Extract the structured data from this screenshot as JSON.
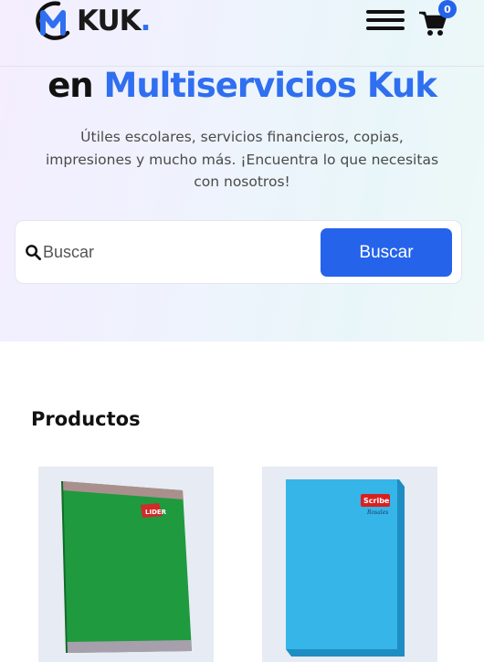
{
  "header": {
    "logo_text": "KUK",
    "logo_dot": ".",
    "cart_count": "0"
  },
  "hero": {
    "title_prefix": "en ",
    "title_accent": "Multiservicios Kuk",
    "description": "Útiles escolares, servicios financieros, copias, impresiones y mucho más. ¡Encuentra lo que necesitas con nosotros!"
  },
  "search": {
    "placeholder": "Buscar",
    "button_label": "Buscar"
  },
  "products": {
    "title": "Productos",
    "items": [
      {
        "brand": "LIDER",
        "cover_color": "#1f9a3f"
      },
      {
        "brand": "Scribe",
        "brand_sub": "Rosales",
        "cover_color": "#35b5e8"
      }
    ]
  },
  "colors": {
    "accent": "#2f6ff0",
    "button": "#2563eb"
  },
  "icons": {
    "menu": "hamburger-icon",
    "cart": "shopping-cart-icon",
    "search": "magnifier-icon"
  }
}
